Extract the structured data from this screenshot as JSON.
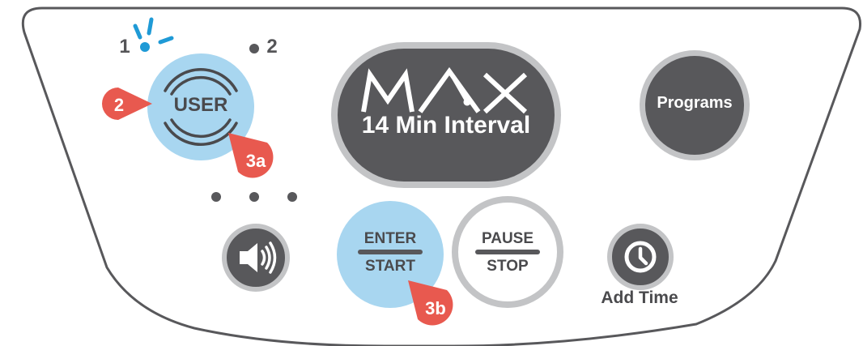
{
  "user_indicator": {
    "label_1": "1",
    "label_2": "2"
  },
  "user_button": {
    "label": "USER"
  },
  "max_display": {
    "logo": "MAX",
    "subtitle": "14 Min Interval"
  },
  "programs_button": {
    "label": "Programs"
  },
  "level_dots": [
    "",
    "",
    ""
  ],
  "volume_button": {
    "icon": "speaker-icon"
  },
  "enter_start_button": {
    "top_label": "ENTER",
    "bottom_label": "START"
  },
  "pause_stop_button": {
    "top_label": "PAUSE",
    "bottom_label": "STOP"
  },
  "add_time_button": {
    "icon": "clock-icon",
    "label": "Add Time"
  },
  "callouts": {
    "step_2": "2",
    "step_3a": "3a",
    "step_3b": "3b"
  },
  "colors": {
    "outline": "#58585b",
    "button_light_blue": "#a8d6f0",
    "button_dark": "#58585b",
    "ring_gray": "#c3c4c6",
    "callout_red": "#e8594f",
    "indicator_blue": "#1f9ad6"
  }
}
